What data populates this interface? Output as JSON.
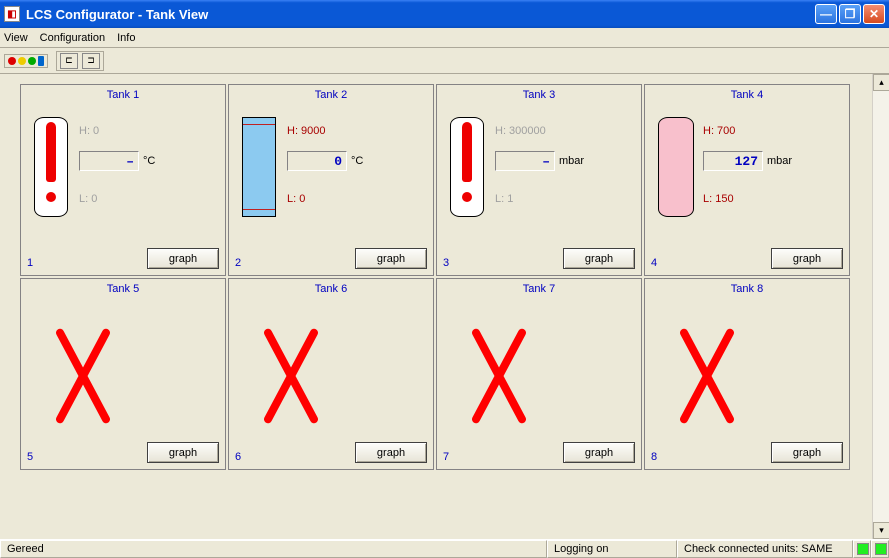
{
  "window": {
    "title": "LCS Configurator - Tank View",
    "icon_label": "◧"
  },
  "menu": {
    "view": "View",
    "configuration": "Configuration",
    "info": "Info"
  },
  "toolbar": {
    "color_buttons": "color-levels",
    "layout_buttons": "layout-toggle"
  },
  "tanks": [
    {
      "num": "1",
      "name": "Tank 1",
      "active": true,
      "visual": "exclamation",
      "hi": "H: 0",
      "lo": "L: 0",
      "hi_dim": true,
      "lo_dim": true,
      "value": "–",
      "unit": "°C",
      "graph": "graph"
    },
    {
      "num": "2",
      "name": "Tank 2",
      "active": true,
      "visual": "rect",
      "hi": "H: 9000",
      "lo": "L: 0",
      "hi_dim": false,
      "lo_dim": false,
      "value": "0",
      "unit": "°C",
      "graph": "graph"
    },
    {
      "num": "3",
      "name": "Tank 3",
      "active": true,
      "visual": "exclamation",
      "hi": "H: 300000",
      "lo": "L: 1",
      "hi_dim": true,
      "lo_dim": true,
      "value": "–",
      "unit": "mbar",
      "graph": "graph"
    },
    {
      "num": "4",
      "name": "Tank 4",
      "active": true,
      "visual": "pill",
      "hi": "H: 700",
      "lo": "L: 150",
      "hi_dim": false,
      "lo_dim": false,
      "value": "127",
      "unit": "mbar",
      "graph": "graph"
    },
    {
      "num": "5",
      "name": "Tank 5",
      "active": false,
      "graph": "graph"
    },
    {
      "num": "6",
      "name": "Tank 6",
      "active": false,
      "graph": "graph"
    },
    {
      "num": "7",
      "name": "Tank 7",
      "active": false,
      "graph": "graph"
    },
    {
      "num": "8",
      "name": "Tank 8",
      "active": false,
      "graph": "graph"
    }
  ],
  "status": {
    "left": "Gereed",
    "middle": "Logging on",
    "right": "Check connected units: SAME",
    "led1": "ok",
    "led2": "ok"
  }
}
